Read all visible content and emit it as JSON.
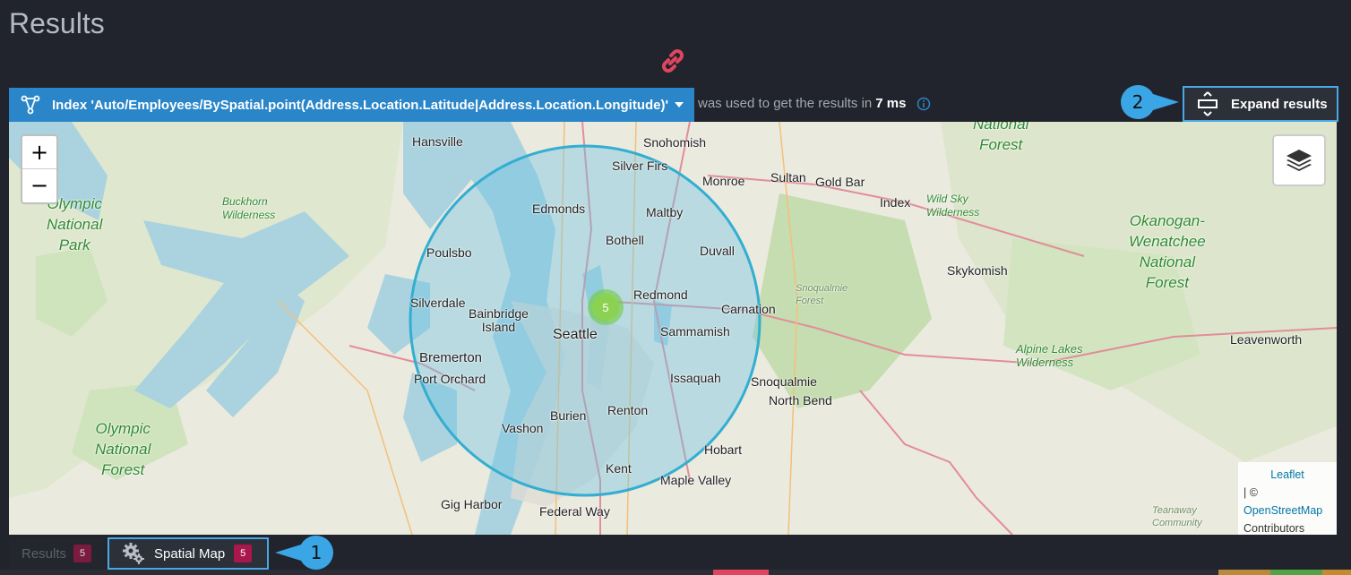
{
  "page": {
    "title": "Results"
  },
  "index_bar": {
    "label": "Index 'Auto/Employees/BySpatial.point(Address.Location.Latitude|Address.Location.Longitude)'"
  },
  "query_info": {
    "prefix": "was used to get the results in",
    "duration": "7 ms"
  },
  "expand_button": {
    "label": "Expand results"
  },
  "callouts": {
    "one": "1",
    "two": "2"
  },
  "map": {
    "zoom_in": "+",
    "zoom_out": "−",
    "cluster_count": "5",
    "attribution": {
      "leaflet": "Leaflet",
      "sep": "| ©",
      "osm": "OpenStreetMap",
      "contributors": "Contributors"
    },
    "labels": {
      "hansville": "Hansville",
      "snohomish": "Snohomish",
      "silver_firs": "Silver Firs",
      "monroe": "Monroe",
      "sultan": "Sultan",
      "gold_bar": "Gold Bar",
      "index": "Index",
      "edmonds": "Edmonds",
      "maltby": "Maltby",
      "bothell": "Bothell",
      "duvall": "Duvall",
      "poulsbo": "Poulsbo",
      "silverdale": "Silverdale",
      "bainbridge": "Bainbridge\nIsland",
      "redmond": "Redmond",
      "carnation": "Carnation",
      "seattle": "Seattle",
      "sammamish": "Sammamish",
      "bremerton": "Bremerton",
      "port_orchard": "Port Orchard",
      "issaquah": "Issaquah",
      "snoqualmie": "Snoqualmie",
      "north_bend": "North Bend",
      "burien": "Burien",
      "renton": "Renton",
      "vashon": "Vashon",
      "kent": "Kent",
      "hobart": "Hobart",
      "maple_valley": "Maple Valley",
      "gig_harbor": "Gig Harbor",
      "federal_way": "Federal Way",
      "skykomish": "Skykomish",
      "leavenworth": "Leavenworth",
      "olympic_np_1": "Olympic\nNational\nPark",
      "olympic_nf": "Olympic\nNational\nForest",
      "buckhorn": "Buckhorn\nWilderness",
      "wild_sky": "Wild Sky\nWilderness",
      "okanogan": "Okanogan-\nWenatchee\nNational\nForest",
      "national_forest_top": "National\nForest",
      "snoqualmie_forest": "Snoqualmie\nForest",
      "alpine_lakes": "Alpine Lakes\nWilderness",
      "teanaway": "Teanaway\nCommunity"
    }
  },
  "tabs": {
    "results": {
      "label": "Results",
      "count": "5"
    },
    "spatial_map": {
      "label": "Spatial Map",
      "count": "5"
    }
  },
  "colors": {
    "background": "#21242c",
    "index_bar": "#2a86c8",
    "highlight": "#49a9e6",
    "badge": "#a9174d",
    "circle": "#33aed1",
    "cluster": "#6ecc39",
    "link_icon": "#e0455f"
  },
  "icons": {
    "link": "link-icon",
    "index": "index-icon",
    "info": "info-icon",
    "expand": "expand-icon",
    "layers": "layers-icon",
    "gear": "gears-icon"
  }
}
